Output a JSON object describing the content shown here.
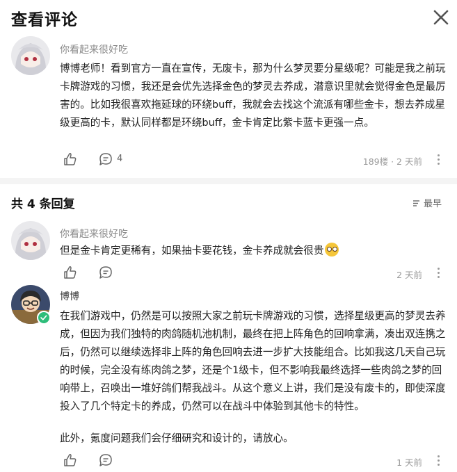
{
  "header": {
    "title": "查看评论"
  },
  "main_comment": {
    "username": "你看起来很好吃",
    "text": "博博老师！看到官方一直在宣传，无废卡，那为什么梦灵要分星级呢？可能是我之前玩卡牌游戏的习惯，我还是会优先选择金色的梦灵去养成，潜意识里就会觉得金色是最厉害的。比如我很喜欢拖延球的环绕buff，我就会去找这个流派有哪些金卡，想去养成星级更高的卡，默认同样都是环绕buff，金卡肯定比紫卡蓝卡更强一点。",
    "reply_count": "4",
    "meta": "189楼 · 2 天前"
  },
  "replies_header": {
    "label": "共 4 条回复",
    "sort_label": "最早"
  },
  "replies": [
    {
      "username": "你看起来很好吃",
      "text": "但是金卡肯定更稀有，如果抽卡要花钱，金卡养成就会很贵",
      "meta": "2 天前"
    },
    {
      "username": "博博",
      "text": "在我们游戏中，仍然是可以按照大家之前玩卡牌游戏的习惯，选择星级更高的梦灵去养成，但因为我们独特的肉鸽随机池机制，最终在把上阵角色的回响拿满，凑出双连携之后，仍然可以继续选择非上阵的角色回响去进一步扩大技能组合。比如我这几天自己玩的时候，完全没有练肉鸽之梦，还是个1级卡，但不影响我最终选择一些肉鸽之梦的回响带上，召唤出一堆好鸽们帮我战斗。从这个意义上讲，我们是没有废卡的，即使深度投入了几个特定卡的养成，仍然可以在战斗中体验到其他卡的特性。",
      "text2": "此外，氪度问题我们会仔细研究和设计的，请放心。",
      "meta": "1 天前"
    }
  ]
}
